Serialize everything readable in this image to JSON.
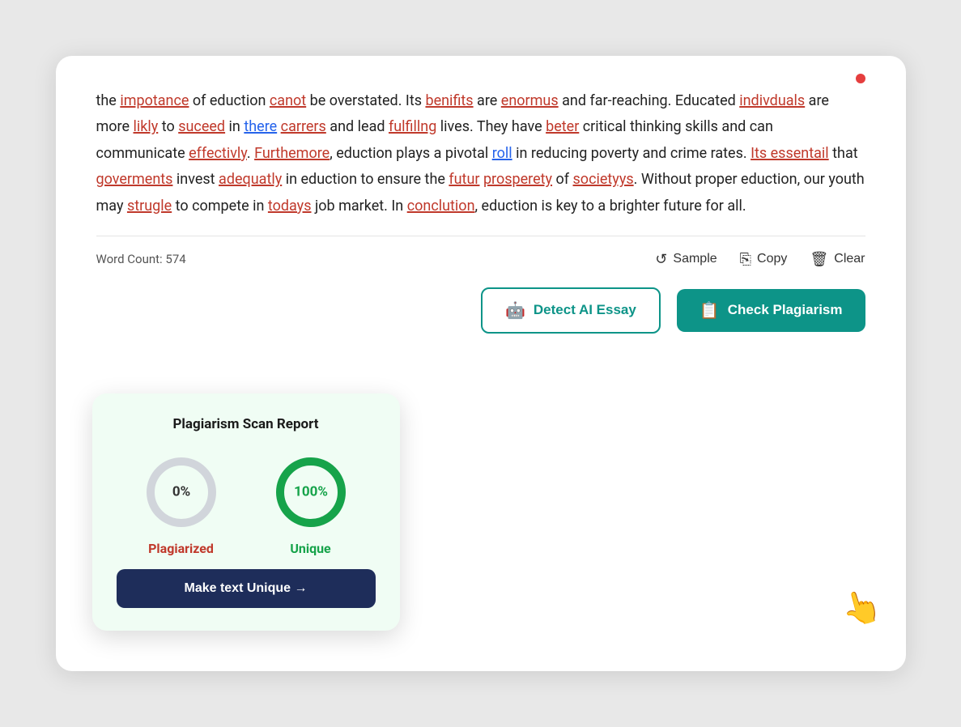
{
  "card": {
    "text_paragraphs": [
      {
        "parts": [
          {
            "text": "the ",
            "type": "normal"
          },
          {
            "text": "impotance",
            "type": "misspelled"
          },
          {
            "text": " of eduction ",
            "type": "normal"
          },
          {
            "text": "canot",
            "type": "misspelled"
          },
          {
            "text": " be overstated. Its ",
            "type": "normal"
          },
          {
            "text": "benifits",
            "type": "misspelled"
          },
          {
            "text": " are ",
            "type": "normal"
          },
          {
            "text": "enormus",
            "type": "misspelled"
          },
          {
            "text": " and far-reaching. Educated ",
            "type": "normal"
          },
          {
            "text": "indivduals",
            "type": "misspelled"
          },
          {
            "text": " are more ",
            "type": "normal"
          },
          {
            "text": "likly",
            "type": "misspelled"
          },
          {
            "text": " to ",
            "type": "normal"
          },
          {
            "text": "suceed",
            "type": "misspelled"
          },
          {
            "text": " in ",
            "type": "normal"
          },
          {
            "text": "there",
            "type": "grammar"
          },
          {
            "text": " ",
            "type": "normal"
          },
          {
            "text": "carrers",
            "type": "misspelled"
          },
          {
            "text": " and lead ",
            "type": "normal"
          },
          {
            "text": "fulfillng",
            "type": "misspelled"
          },
          {
            "text": " lives. They have ",
            "type": "normal"
          },
          {
            "text": "beter",
            "type": "misspelled"
          },
          {
            "text": " critical thinking skills and can communicate ",
            "type": "normal"
          },
          {
            "text": "effectivly",
            "type": "misspelled"
          },
          {
            "text": ". ",
            "type": "normal"
          },
          {
            "text": "Furthemore",
            "type": "misspelled"
          },
          {
            "text": ", eduction plays a pivotal ",
            "type": "normal"
          },
          {
            "text": "roll",
            "type": "grammar"
          },
          {
            "text": " in reducing poverty and crime rates. ",
            "type": "normal"
          },
          {
            "text": "Its essentail",
            "type": "misspelled"
          },
          {
            "text": " that ",
            "type": "normal"
          },
          {
            "text": "goverments",
            "type": "misspelled"
          },
          {
            "text": " invest ",
            "type": "normal"
          },
          {
            "text": "adequatly",
            "type": "misspelled"
          },
          {
            "text": " in eduction to ensure the ",
            "type": "normal"
          },
          {
            "text": "futur",
            "type": "misspelled"
          },
          {
            "text": " ",
            "type": "normal"
          },
          {
            "text": "prosperety",
            "type": "misspelled"
          },
          {
            "text": " of ",
            "type": "normal"
          },
          {
            "text": "societyys",
            "type": "misspelled"
          },
          {
            "text": ". Without proper eduction, our youth may ",
            "type": "normal"
          },
          {
            "text": "strugle",
            "type": "misspelled"
          },
          {
            "text": " to compete in ",
            "type": "normal"
          },
          {
            "text": "todays",
            "type": "misspelled"
          },
          {
            "text": " job market. In ",
            "type": "normal"
          },
          {
            "text": "conclution",
            "type": "misspelled"
          },
          {
            "text": ", eduction is key to a brighter future for all.",
            "type": "normal"
          }
        ]
      }
    ],
    "word_count_label": "Word Count: 574",
    "toolbar": {
      "sample_label": "Sample",
      "copy_label": "Copy",
      "clear_label": "Clear"
    },
    "buttons": {
      "detect_ai_label": "Detect AI Essay",
      "check_plagiarism_label": "Check Plagiarism"
    }
  },
  "plagiarism_report": {
    "title": "Plagiarism Scan Report",
    "plagiarized_percent": "0%",
    "unique_percent": "100%",
    "plagiarized_label": "Plagiarized",
    "unique_label": "Unique",
    "make_unique_label": "Make text Unique →"
  }
}
